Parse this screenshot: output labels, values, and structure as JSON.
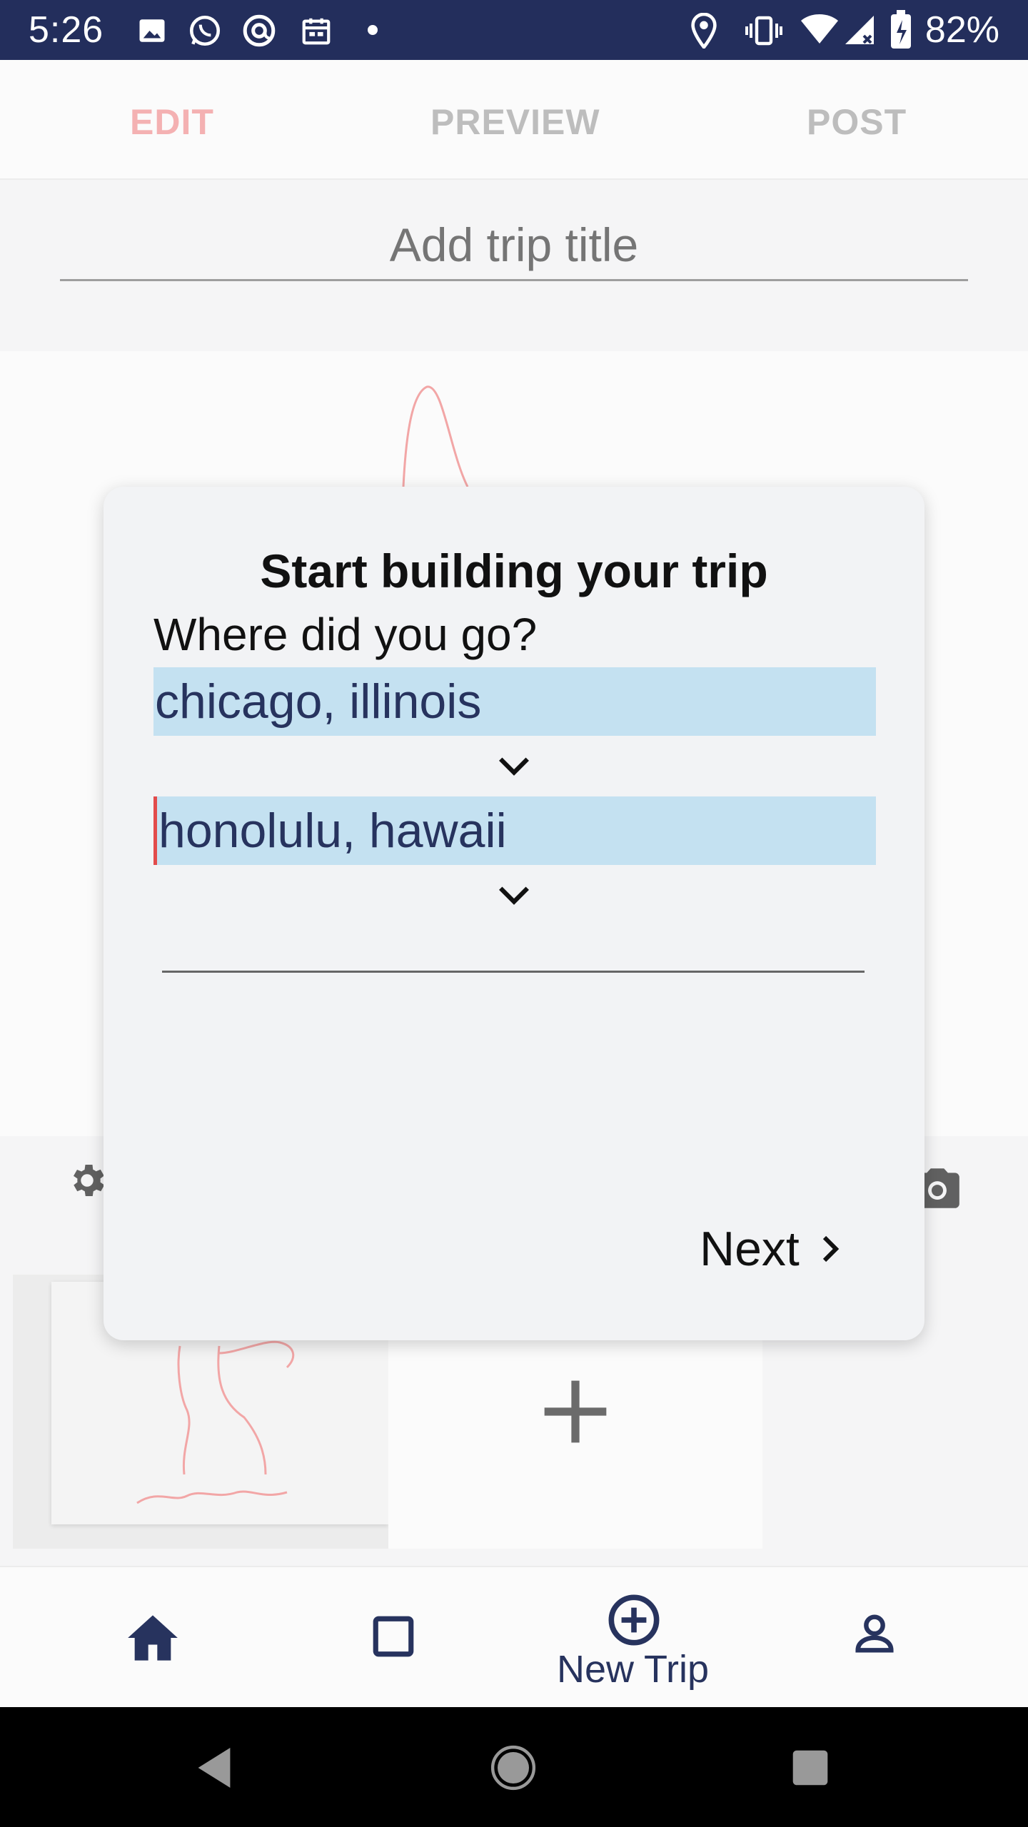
{
  "status_bar": {
    "time": "5:26",
    "battery": "82%",
    "icons": [
      "image-icon",
      "whatsapp-icon",
      "at-icon",
      "calendar-icon",
      "dot-icon",
      "location-icon",
      "vibrate-icon",
      "wifi-icon",
      "signal-icon",
      "battery-icon"
    ]
  },
  "tabs": {
    "edit": "EDIT",
    "preview": "PREVIEW",
    "post": "POST",
    "active": "edit",
    "active_color": "#f4b1b2"
  },
  "title_input": {
    "placeholder": "Add trip title"
  },
  "modal": {
    "title": "Start building your trip",
    "question": "Where did you go?",
    "locations": [
      "chicago, illinois",
      "honolulu, hawaii"
    ],
    "next_label": "Next"
  },
  "bottom_nav": {
    "items": [
      "home-icon",
      "square-icon",
      "add-circle-icon",
      "person-icon"
    ],
    "new_trip_label": "New Trip",
    "accent": "#27335e"
  },
  "colors": {
    "status_bar": "#232e5c",
    "field_highlight": "#c4e1f1",
    "sketch": "#f2a6a6"
  }
}
